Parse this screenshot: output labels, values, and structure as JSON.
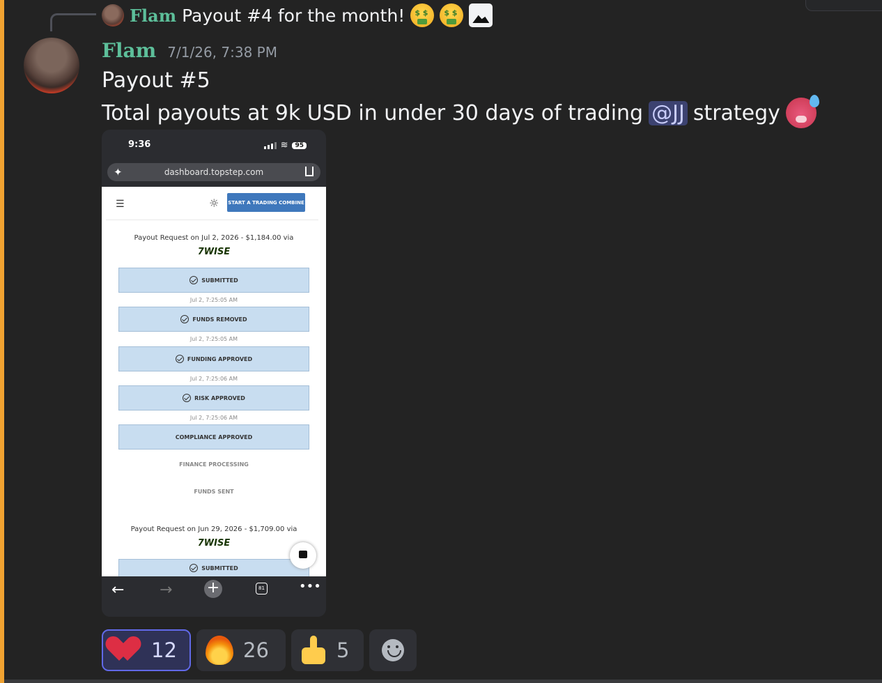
{
  "reply": {
    "author": "Flam",
    "text": "Payout #4 for the month!",
    "icons": [
      "money-mouth-face-icon",
      "money-mouth-face-icon",
      "image-icon"
    ]
  },
  "message": {
    "author": "Flam",
    "timestamp": "7/1/26, 7:38 PM",
    "line1": "Payout #5",
    "line2_before": "Total payouts at 9k USD in under 30 days of trading",
    "mention": "@JJ",
    "line2_after": "strategy",
    "emoji": "hot-face-icon"
  },
  "screenshot": {
    "status": {
      "time": "9:36",
      "battery": "95"
    },
    "url": "dashboard.topstep.com",
    "cta": "START A TRADING COMBINE",
    "payout1": {
      "title": "Payout Request on Jul 2, 2026 - $1,184.00 via",
      "provider": "7WISE",
      "steps": [
        {
          "label": "SUBMITTED",
          "time": "Jul 2, 7:25:05 AM"
        },
        {
          "label": "FUNDS REMOVED",
          "time": "Jul 2, 7:25:05 AM"
        },
        {
          "label": "FUNDING APPROVED",
          "time": "Jul 2, 7:25:06 AM"
        },
        {
          "label": "RISK APPROVED",
          "time": "Jul 2, 7:25:06 AM"
        },
        {
          "label": "COMPLIANCE APPROVED"
        }
      ],
      "pending": [
        "FINANCE PROCESSING",
        "FUNDS SENT"
      ]
    },
    "payout2": {
      "title": "Payout Request on Jun 29, 2026 - $1,709.00 via",
      "provider": "7WISE",
      "step": "SUBMITTED"
    },
    "tabs_count": "81"
  },
  "reactions": [
    {
      "icon": "heart-icon",
      "count": "12",
      "active": true
    },
    {
      "icon": "fire-icon",
      "count": "26",
      "active": false
    },
    {
      "icon": "thumbs-up-icon",
      "count": "5",
      "active": false
    },
    {
      "icon": "add-reaction-icon",
      "count": "",
      "active": false
    }
  ]
}
